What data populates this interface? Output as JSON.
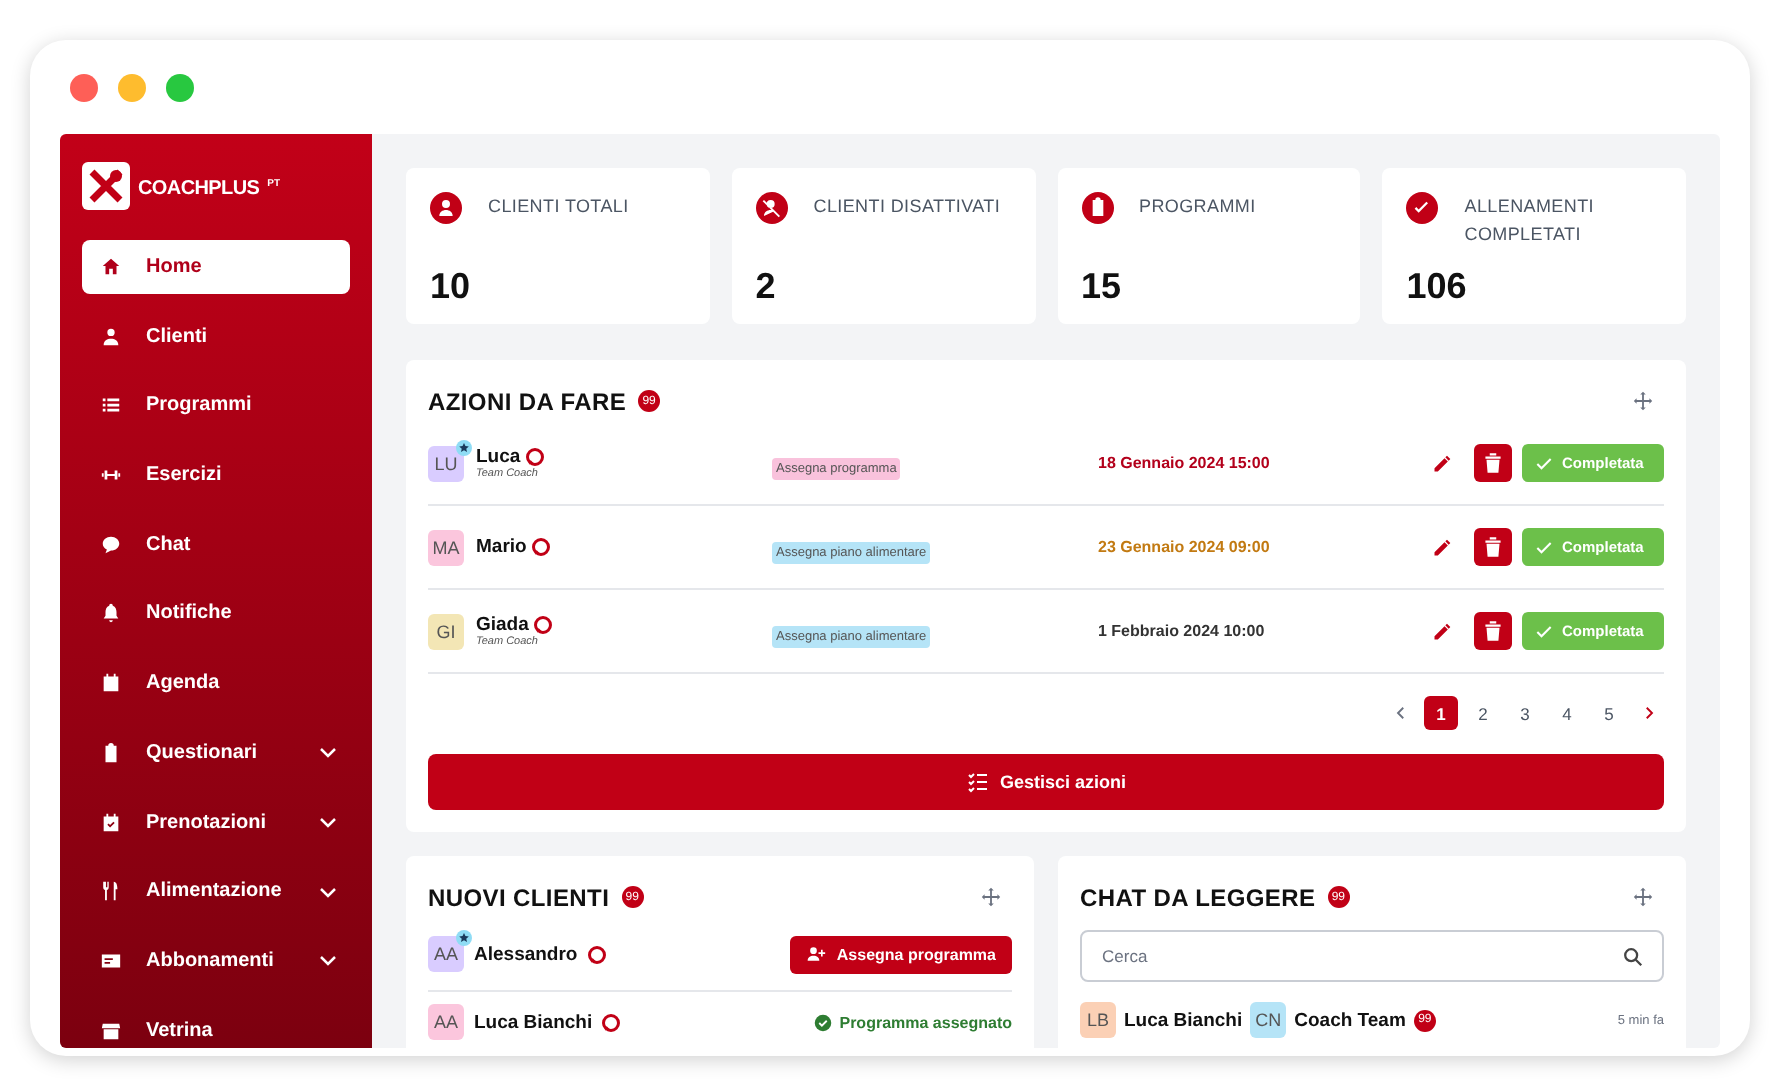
{
  "window": {
    "controls": [
      {
        "color": "#fe5f57"
      },
      {
        "color": "#febc2e"
      },
      {
        "color": "#28c840"
      }
    ]
  },
  "sidebar": {
    "logo": {
      "text": "COACHPLUS",
      "suffix": "PT"
    },
    "items": [
      {
        "label": "Home",
        "selected": true,
        "expandable": false
      },
      {
        "label": "Clienti",
        "selected": false,
        "expandable": false
      },
      {
        "label": "Programmi",
        "selected": false,
        "expandable": false
      },
      {
        "label": "Esercizi",
        "selected": false,
        "expandable": false
      },
      {
        "label": "Chat",
        "selected": false,
        "expandable": false
      },
      {
        "label": "Notifiche",
        "selected": false,
        "expandable": false
      },
      {
        "label": "Agenda",
        "selected": false,
        "expandable": false
      },
      {
        "label": "Questionari",
        "selected": false,
        "expandable": true
      },
      {
        "label": "Prenotazioni",
        "selected": false,
        "expandable": true
      },
      {
        "label": "Alimentazione",
        "selected": false,
        "expandable": true
      },
      {
        "label": "Abbonamenti",
        "selected": false,
        "expandable": true
      },
      {
        "label": "Vetrina",
        "selected": false,
        "expandable": false
      }
    ]
  },
  "stats": [
    {
      "label": "CLIENTI TOTALI",
      "value": "10"
    },
    {
      "label": "CLIENTI DISATTIVATI",
      "value": "2"
    },
    {
      "label": "PROGRAMMI",
      "value": "15"
    },
    {
      "label": "ALLENAMENTI COMPLETATI",
      "value": "106"
    }
  ],
  "actions": {
    "title": "AZIONI DA FARE",
    "badge": "99",
    "rows": [
      {
        "person": {
          "initials": "LU",
          "color": "#d9ccff",
          "name": "Luca",
          "starred": true,
          "subtitle": "Team Coach"
        },
        "tag": {
          "text": "Assegna programma",
          "color": "#f9c2dc"
        },
        "date": {
          "text": "18 Gennaio 2024 15:00",
          "color": "#b3001b"
        },
        "complete_label": "Completata"
      },
      {
        "person": {
          "initials": "MA",
          "color": "#fbc6dd",
          "name": "Mario",
          "starred": false
        },
        "tag": {
          "text": "Assegna piano alimentare",
          "color": "#b5e4f7"
        },
        "date": {
          "text": "23 Gennaio 2024 09:00",
          "color": "#c27a12"
        },
        "complete_label": "Completata"
      },
      {
        "person": {
          "initials": "GI",
          "color": "#f3e6b5",
          "name": "Giada",
          "starred": false,
          "subtitle": "Team Coach"
        },
        "tag": {
          "text": "Assegna piano alimentare",
          "color": "#b5e4f7"
        },
        "date": {
          "text": "1 Febbraio 2024 10:00",
          "color": "#333333"
        },
        "complete_label": "Completata"
      }
    ],
    "pages": [
      {
        "label": "1",
        "selected": true
      },
      {
        "label": "2",
        "selected": false
      },
      {
        "label": "3",
        "selected": false
      },
      {
        "label": "4",
        "selected": false
      },
      {
        "label": "5",
        "selected": false
      }
    ],
    "manage_button": "Gestisci azioni"
  },
  "new_clients": {
    "title": "NUOVI CLIENTI",
    "badge": "99",
    "rows": [
      {
        "kind": "action",
        "initials": "AA",
        "color": "#d9ccff",
        "name": "Alessandro",
        "starred": true,
        "action": "Assegna programma"
      },
      {
        "kind": "status",
        "initials": "AA",
        "color": "#fbc6dd",
        "name": "Luca Bianchi",
        "starred": false,
        "status": "Programma assegnato"
      }
    ]
  },
  "chats": {
    "title": "CHAT DA LEGGERE",
    "badge": "99",
    "search": {
      "placeholder": "Cerca"
    },
    "rows": [
      {
        "initials": "LB",
        "color": "#fbd0b5",
        "name": "Luca Bianchi",
        "coach": {
          "initials": "CN",
          "color": "#b5e4f7",
          "name": "Coach Team"
        },
        "badge": "99",
        "time": "5 min fa"
      }
    ]
  }
}
